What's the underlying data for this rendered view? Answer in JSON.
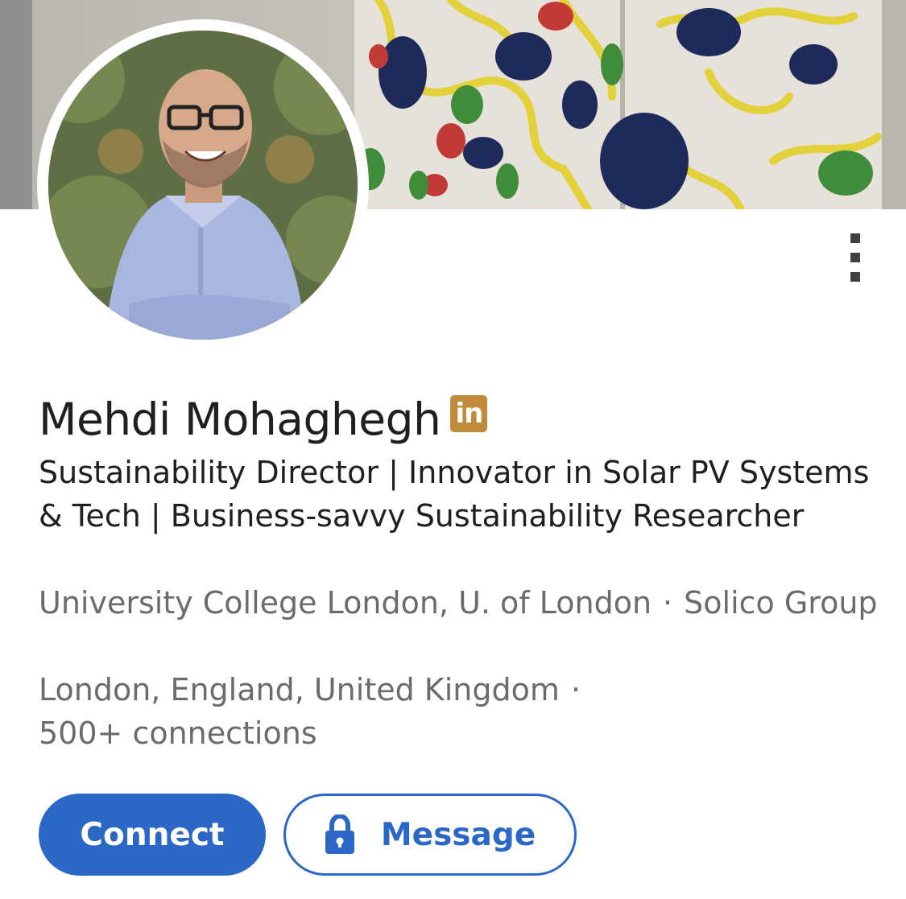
{
  "profile": {
    "name": "Mehdi Mohaghegh",
    "badge": "in",
    "headline": "Sustainability Director | Innovator in Solar PV Systems & Tech | Business-savvy Sustainability Researcher",
    "education": "University College London, U. of London",
    "company": "Solico Group",
    "separator": "·",
    "location": "London, England, United Kingdom",
    "connections": "500+ connections"
  },
  "actions": {
    "connect_label": "Connect",
    "message_label": "Message"
  },
  "icons": {
    "menu": "vertical-ellipsis-icon",
    "badge": "linkedin-premium-icon",
    "lock": "lock-icon"
  },
  "colors": {
    "accent": "#2a67c7",
    "premium_badge": "#c08b3a",
    "primary_text": "#1f1f1f",
    "secondary_text": "#6b6b6b"
  }
}
